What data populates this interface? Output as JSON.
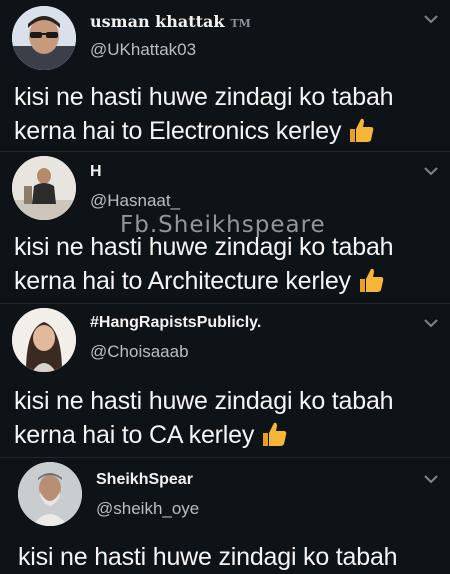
{
  "tweets": [
    {
      "name": "usman khattak",
      "badge": "TM",
      "handle": "@UKhattak03",
      "line1": "kisi ne hasti huwe zindagi ko tabah",
      "line2": "kerna hai to Electronics kerley",
      "emoji": "thumbs-up-icon"
    },
    {
      "name": "H",
      "handle": "@Hasnaat_",
      "line1": "kisi ne hasti huwe zindagi ko tabah",
      "line2": "kerna hai to Architecture kerley",
      "emoji": "thumbs-up-icon"
    },
    {
      "name": "#HangRapistsPublicly.",
      "handle": "@Choisaaab",
      "line1": "kisi ne hasti huwe zindagi ko tabah",
      "line2": "kerna hai to CA kerley",
      "emoji": "thumbs-up-icon"
    },
    {
      "name": "SheikhSpear",
      "handle": "@sheikh_oye",
      "line1": "kisi ne hasti huwe zindagi ko tabah"
    }
  ],
  "watermark": "Fb.Sheikhspeare",
  "colors": {
    "background": "#0e1318",
    "handle": "#b9bec4",
    "chevron": "#7d858d",
    "thumb": "#f6b63a"
  }
}
